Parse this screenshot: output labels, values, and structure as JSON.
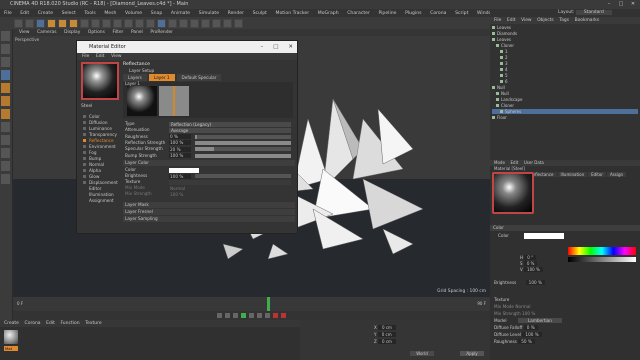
{
  "window": {
    "title": "CINEMA 4D R18.020 Studio (RC - R18) - [Diamond_Leaves.c4d *] - Main"
  },
  "menubar": [
    "File",
    "Edit",
    "Create",
    "Select",
    "Tools",
    "Mesh",
    "Volume",
    "Snap",
    "Animate",
    "Simulate",
    "Render",
    "Sculpt",
    "Motion Tracker",
    "MoGraph",
    "Character",
    "Pipeline",
    "Plugins",
    "Corona",
    "Script",
    "Window",
    "Help"
  ],
  "layout": {
    "label": "Layout:",
    "value": "Standard"
  },
  "viewport": {
    "menu": [
      "View",
      "Cameras",
      "Display",
      "Options",
      "Filter",
      "Panel",
      "ProRender"
    ],
    "label": "Perspective",
    "grid_spacing": "Grid Spacing : 100 cm"
  },
  "object_manager": {
    "tabs": [
      "File",
      "Edit",
      "View",
      "Objects",
      "Tags",
      "Bookmarks"
    ],
    "objects": [
      "Leaves",
      "Diamonds",
      "Leaves",
      "Cloner",
      "1",
      "2",
      "3",
      "4",
      "5",
      "6",
      "Null",
      "Null",
      "Landscape",
      "Cloner",
      "Spheres",
      "Floor"
    ]
  },
  "attribute_manager": {
    "menu": [
      "Mode",
      "Edit",
      "User Data"
    ],
    "header": "Material [Steel]",
    "tabs": [
      "Basic",
      "Color",
      "Reflectance",
      "Illumination",
      "Editor",
      "Assign"
    ],
    "active_tab": "Color",
    "section": "Color",
    "color_label": "Color",
    "brightness_label": "Brightness",
    "brightness_value": "100 %",
    "rgb_labels": [
      "H",
      "S",
      "V"
    ],
    "rgb_values": [
      "0 °",
      "0 %",
      "100 %"
    ],
    "texture_label": "Texture",
    "mix_mode_label": "Mix Mode",
    "mix_mode_value": "Normal",
    "mix_strength_label": "Mix Strength",
    "mix_strength_value": "100 %",
    "model_label": "Model",
    "model_value": "Lambertian",
    "diffuse_falloff_label": "Diffuse Falloff",
    "diffuse_falloff_value": "0 %",
    "diffuse_level_label": "Diffuse Level",
    "diffuse_level_value": "100 %",
    "roughness_label": "Roughness",
    "roughness_value": "50 %"
  },
  "material_editor": {
    "title": "Material Editor",
    "menu": [
      "File",
      "Edit",
      "View"
    ],
    "material_name": "Steel",
    "channels": [
      "Color",
      "Diffusion",
      "Luminance",
      "Transparency",
      "Reflectance",
      "Environment",
      "Fog",
      "Bump",
      "Normal",
      "Alpha",
      "Glow",
      "Displacement",
      "Editor",
      "Illumination",
      "Assignment"
    ],
    "active_channel": "Reflectance",
    "reflectance_title": "Reflectance",
    "layer_setup": "Layer Setup",
    "layer_tabs": [
      "Layers",
      "Layer 1",
      "Default Specular"
    ],
    "active_layer_tab": "Layer 1",
    "layer_label": "Layer 1",
    "props": [
      {
        "label": "Type",
        "value": "Reflection (Legacy)",
        "kind": "dd"
      },
      {
        "label": "Attenuation",
        "value": "Average",
        "kind": "dd"
      },
      {
        "label": "Roughness",
        "value": "0 %",
        "kind": "val",
        "fill": 0.0
      },
      {
        "label": "Reflection Strength",
        "value": "100 %",
        "kind": "val",
        "fill": 1.0
      },
      {
        "label": "Specular Strength",
        "value": "20 %",
        "kind": "val",
        "fill": 0.2
      },
      {
        "label": "Bump Strength",
        "value": "100 %",
        "kind": "val",
        "fill": 1.0
      }
    ],
    "layer_color": "Layer Color",
    "color_props": [
      {
        "label": "Color",
        "value": ""
      },
      {
        "label": "Brightness",
        "value": "100 %"
      },
      {
        "label": "Texture",
        "value": ""
      },
      {
        "label": "Mix Mode",
        "value": "Normal"
      },
      {
        "label": "Mix Strength",
        "value": "100 %"
      }
    ],
    "sections": [
      "Layer Mask",
      "Layer Fresnel",
      "Layer Sampling"
    ]
  },
  "material_bar": {
    "menu": [
      "Create",
      "Corona",
      "Edit",
      "Function",
      "Texture"
    ],
    "material": "Mat"
  },
  "coordinates": {
    "labels": [
      "X",
      "Y",
      "Z"
    ],
    "values": [
      "0 cm",
      "0 cm",
      "0 cm"
    ],
    "apply": "Apply",
    "mode": "World",
    "scale": "Size"
  },
  "timeline": {
    "start": "0 F",
    "end": "90 F",
    "current": "0 F"
  },
  "colors": {
    "accent": "#e08a30",
    "selection": "#5a86c3",
    "bg": "#2b2b2b"
  }
}
